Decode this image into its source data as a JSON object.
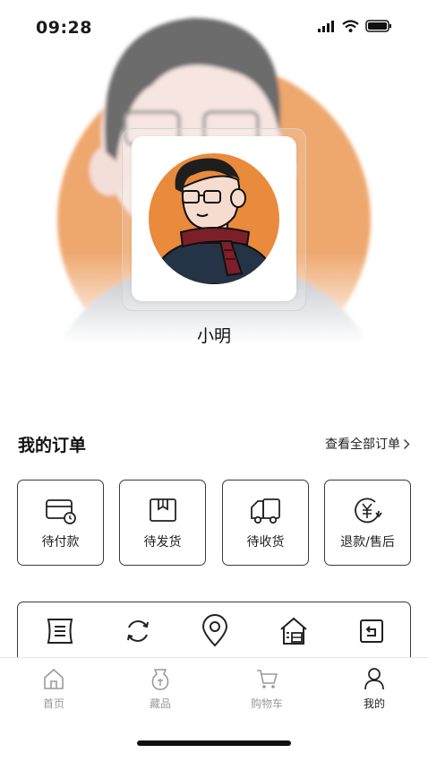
{
  "status_bar": {
    "time": "09:28",
    "icons": [
      "signal-icon",
      "wifi-icon",
      "battery-icon"
    ]
  },
  "profile": {
    "username": "小明",
    "theme_color": "#e98a3c"
  },
  "orders": {
    "title": "我的订单",
    "view_all": "查看全部订单",
    "tiles": [
      {
        "label": "待付款",
        "icon": "wallet-icon"
      },
      {
        "label": "待发货",
        "icon": "package-icon"
      },
      {
        "label": "待收货",
        "icon": "truck-icon"
      },
      {
        "label": "退款/售后",
        "icon": "refund-icon"
      }
    ]
  },
  "services": [
    "ticket-icon",
    "refresh-icon",
    "location-icon",
    "warehouse-icon",
    "return-icon"
  ],
  "tab_bar": {
    "active": "我的",
    "tabs": [
      {
        "label": "首页",
        "icon": "home-icon"
      },
      {
        "label": "藏品",
        "icon": "collection-icon"
      },
      {
        "label": "购物车",
        "icon": "cart-icon"
      },
      {
        "label": "我的",
        "icon": "user-icon"
      }
    ]
  }
}
